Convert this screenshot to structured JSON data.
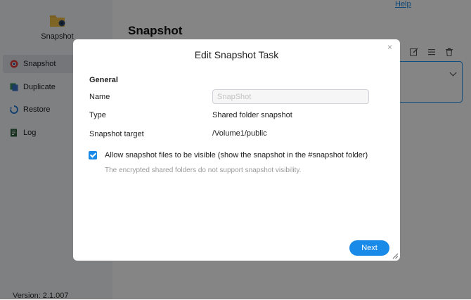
{
  "app": {
    "name": "Snapshot",
    "version": "Version: 2.1.007",
    "help": "Help",
    "page_title": "Snapshot"
  },
  "sidebar": {
    "items": [
      {
        "label": "Snapshot",
        "icon": "snapshot-icon",
        "active": true
      },
      {
        "label": "Duplicate",
        "icon": "duplicate-icon",
        "active": false
      },
      {
        "label": "Restore",
        "icon": "restore-icon",
        "active": false
      },
      {
        "label": "Log",
        "icon": "log-icon",
        "active": false
      }
    ]
  },
  "toolbar": {
    "icons": [
      "edit-icon",
      "list-icon",
      "delete-icon"
    ]
  },
  "dialog": {
    "title": "Edit Snapshot Task",
    "section": "General",
    "name_label": "Name",
    "name_placeholder": "SnapShot",
    "type_label": "Type",
    "type_value": "Shared folder snapshot",
    "target_label": "Snapshot target",
    "target_value": "/Volume1/public",
    "visible_checkbox": {
      "label": "Allow snapshot files to be visible (show the snapshot in the #snapshot folder)",
      "checked": true
    },
    "hint": "The encrypted shared folders do not support snapshot visibility.",
    "next_label": "Next"
  },
  "colors": {
    "accent": "#1a8ae8",
    "overlay": "rgba(0,0,0,0.48)"
  }
}
